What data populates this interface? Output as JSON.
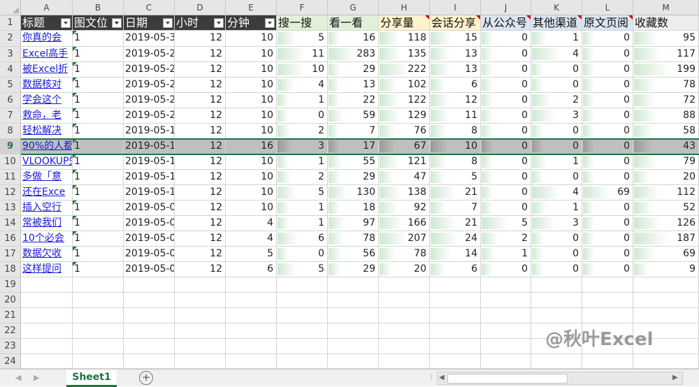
{
  "columns": [
    "A",
    "B",
    "C",
    "D",
    "E",
    "F",
    "G",
    "H",
    "I",
    "J",
    "K",
    "L",
    "M"
  ],
  "row_numbers": [
    "1",
    "2",
    "3",
    "4",
    "5",
    "6",
    "7",
    "8",
    "9",
    "10",
    "11",
    "12",
    "13",
    "14",
    "16",
    "17",
    "18",
    "19",
    "20",
    "21",
    "22",
    "23",
    "24"
  ],
  "headers": [
    "标题",
    "图文位",
    "日期",
    "小时",
    "分钟",
    "搜一搜",
    "看一看",
    "分享量",
    "会话分享",
    "从公众号",
    "其他渠道",
    "原文页阅",
    "收藏数"
  ],
  "rows": [
    [
      "你真的会",
      "1",
      "2019-05-3",
      "12",
      "10",
      "5",
      "16",
      "118",
      "15",
      "0",
      "1",
      "0",
      "95"
    ],
    [
      "Excel高手",
      "1",
      "2019-05-2",
      "12",
      "10",
      "11",
      "283",
      "135",
      "13",
      "0",
      "4",
      "0",
      "117"
    ],
    [
      "被Excel折",
      "1",
      "2019-05-2",
      "12",
      "10",
      "10",
      "29",
      "222",
      "13",
      "0",
      "0",
      "0",
      "199"
    ],
    [
      "数据核对",
      "1",
      "2019-05-2",
      "12",
      "10",
      "4",
      "13",
      "102",
      "6",
      "0",
      "0",
      "0",
      "78"
    ],
    [
      "学会这个",
      "1",
      "2019-05-2",
      "12",
      "10",
      "1",
      "22",
      "122",
      "12",
      "0",
      "2",
      "0",
      "72"
    ],
    [
      "救命，老",
      "1",
      "2019-05-2",
      "12",
      "10",
      "0",
      "59",
      "129",
      "11",
      "0",
      "3",
      "0",
      "88"
    ],
    [
      "轻松解决",
      "1",
      "2019-05-1",
      "12",
      "10",
      "2",
      "7",
      "76",
      "8",
      "0",
      "0",
      "0",
      "58"
    ],
    [
      "90%的人都",
      "1",
      "2019-05-1",
      "12",
      "16",
      "3",
      "17",
      "67",
      "10",
      "0",
      "0",
      "0",
      "43"
    ],
    [
      "VLOOKUP失",
      "1",
      "2019-05-1",
      "12",
      "10",
      "1",
      "55",
      "121",
      "8",
      "0",
      "1",
      "0",
      "79"
    ],
    [
      "多做「意",
      "1",
      "2019-05-1",
      "12",
      "10",
      "2",
      "29",
      "47",
      "5",
      "0",
      "0",
      "0",
      "20"
    ],
    [
      "还在Exce",
      "1",
      "2019-05-1",
      "12",
      "10",
      "5",
      "130",
      "138",
      "21",
      "0",
      "4",
      "69",
      "112"
    ],
    [
      "插入空行",
      "1",
      "2019-05-0",
      "12",
      "10",
      "1",
      "18",
      "92",
      "7",
      "0",
      "1",
      "0",
      "52"
    ],
    [
      "常被我们",
      "1",
      "2019-05-0",
      "12",
      "4",
      "1",
      "97",
      "166",
      "21",
      "5",
      "3",
      "0",
      "126"
    ],
    [
      "10个必会",
      "1",
      "2019-05-0",
      "12",
      "4",
      "6",
      "78",
      "207",
      "24",
      "2",
      "0",
      "0",
      "187"
    ],
    [
      "数据欠收",
      "1",
      "2019-05-0",
      "12",
      "5",
      "0",
      "56",
      "78",
      "14",
      "1",
      "0",
      "0",
      "69"
    ],
    [
      "这样提问",
      "1",
      "2019-05-0",
      "12",
      "6",
      "5",
      "29",
      "20",
      "6",
      "0",
      "0",
      "0",
      "9"
    ]
  ],
  "sheet_tab": "Sheet1",
  "add_sheet_symbol": "+",
  "watermark_text": "@秋叶Excel",
  "colors": {
    "accent": "#1f7244",
    "header_dark": "#3c3c3c",
    "databar": "#cfe8d2",
    "link": "#1a1adb"
  }
}
